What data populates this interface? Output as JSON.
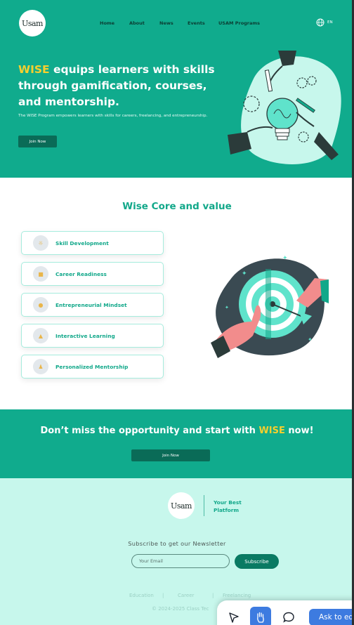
{
  "header": {
    "logo_text": "Usam",
    "nav": [
      "Home",
      "About",
      "News",
      "Events",
      "USAM Programs"
    ],
    "language": "EN"
  },
  "hero": {
    "title_accent": "WISE",
    "title_rest": " equips learners with skills through gamification, courses, and mentorship.",
    "subtitle": "The WISE Program empowers learners with skills for careers, freelancing, and entrepreneurship.",
    "cta_label": "Join Now"
  },
  "core": {
    "title": "Wise Core and value",
    "items": [
      {
        "label": "Skill Development",
        "icon": "lightbulb-icon"
      },
      {
        "label": "Career Readiness",
        "icon": "briefcase-icon"
      },
      {
        "label": "Entrepreneurial Mindset",
        "icon": "brain-icon"
      },
      {
        "label": "Interactive Learning",
        "icon": "chart-icon"
      },
      {
        "label": "Personalized Mentorship",
        "icon": "mentor-icon"
      }
    ]
  },
  "cta": {
    "title_start": "Don’t miss the opportunity and start with ",
    "title_accent": "WISE",
    "title_end": " now!",
    "button_label": "Join Now"
  },
  "footer": {
    "logo_text": "Usam",
    "tagline": "Your Best Platform",
    "newsletter_title": "Subscribe to get our Newsletter",
    "email_placeholder": "Your Email",
    "subscribe_label": "Subscribe",
    "links": [
      "Education",
      "Career",
      "Freelancing"
    ],
    "link_separator": "|",
    "copyright": "© 2024-2025 Class Tec"
  },
  "toolbar": {
    "ask_label": "Ask to ed"
  },
  "colors": {
    "primary": "#10ab8d",
    "accent": "#f6cf2e",
    "dark_button": "#0a6b57",
    "footer_bg": "#c7f7ec",
    "toolbar_accent": "#3d7be0"
  }
}
